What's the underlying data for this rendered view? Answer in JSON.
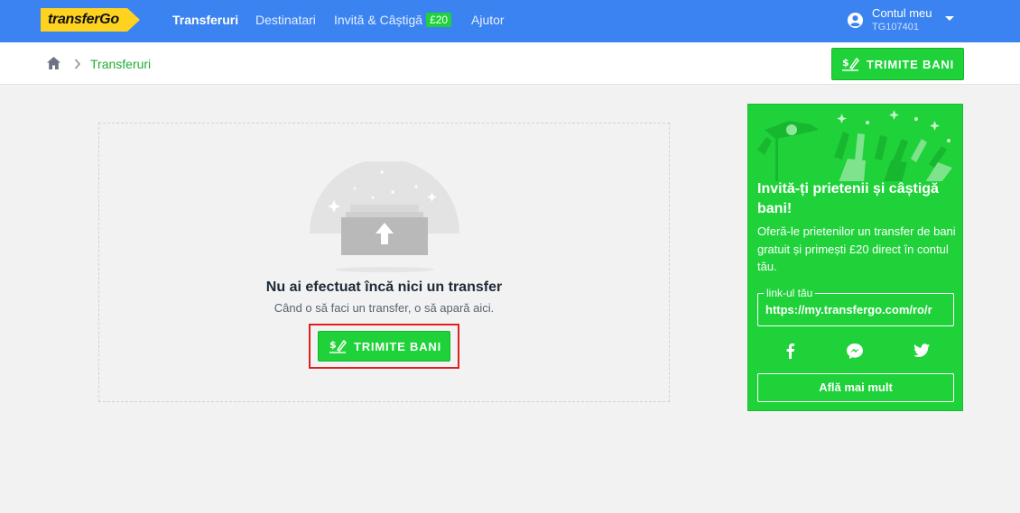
{
  "header": {
    "logo_text": "transferGo",
    "nav": {
      "transfers": "Transferuri",
      "recipients": "Destinatari",
      "invite": "Invită & Câștigă",
      "invite_badge": "£20",
      "help": "Ajutor"
    },
    "account": {
      "name": "Contul meu",
      "id": "TG107401"
    }
  },
  "breadcrumb": {
    "separator": ">",
    "current": "Transferuri"
  },
  "actions": {
    "send_money": "TRIMITE BANI"
  },
  "empty_state": {
    "title": "Nu ai efectuat încă nici un transfer",
    "subtitle": "Când o să faci un transfer, o să apară aici.",
    "button": "TRIMITE BANI"
  },
  "promo": {
    "title": "Invită-ți prietenii și câștigă bani!",
    "body": "Oferă-le prietenilor un transfer de bani gratuit și primești £20 direct în contul tău.",
    "link_label": "link-ul tău",
    "link_value": "https://my.transfergo.com/ro/r",
    "learn_more": "Află mai mult",
    "social_icons": [
      "facebook-icon",
      "messenger-icon",
      "twitter-icon"
    ]
  },
  "colors": {
    "nav_blue": "#3b83f0",
    "brand_green": "#1fd23a",
    "logo_yellow": "#ffd21f",
    "highlight_red": "#e02020"
  }
}
